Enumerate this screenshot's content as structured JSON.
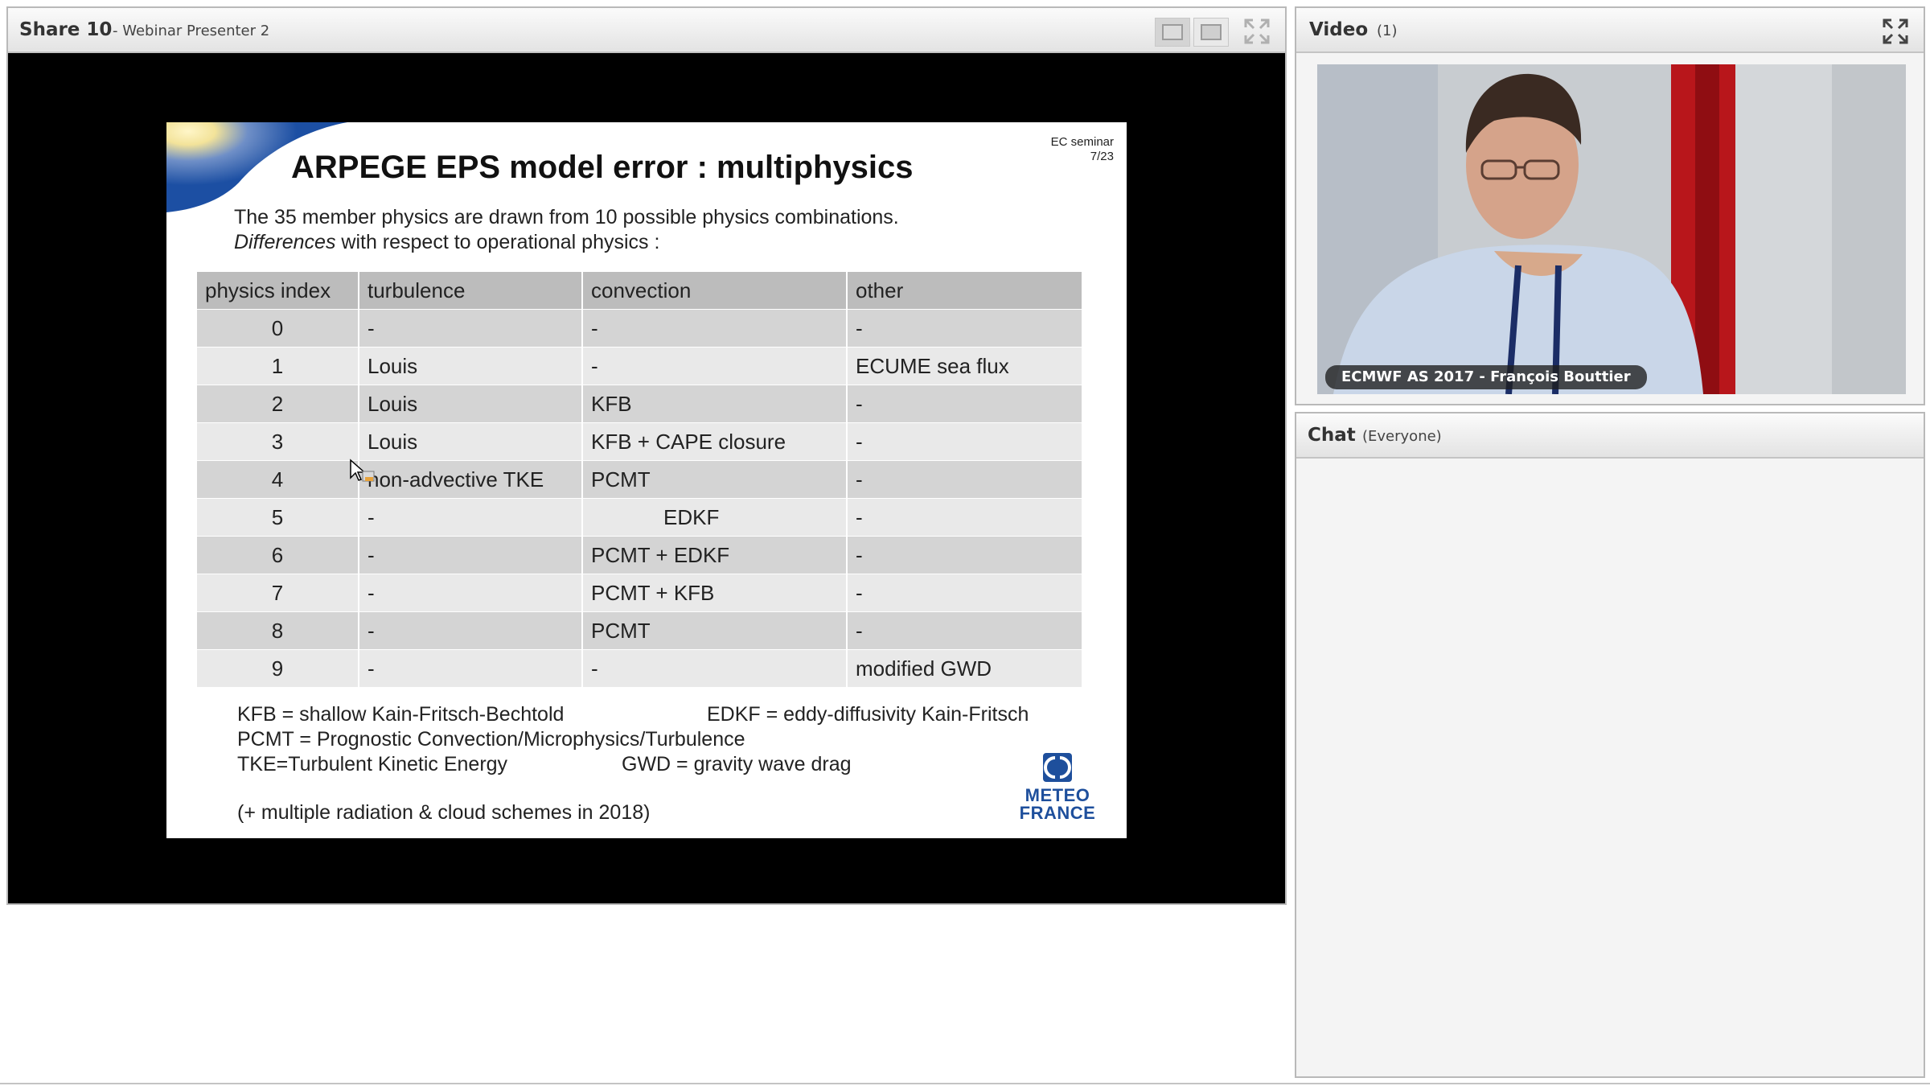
{
  "share_pod": {
    "title": "Share 10",
    "subtitle": "- Webinar Presenter 2"
  },
  "slide": {
    "title": "ARPEGE EPS model error : multiphysics",
    "ref_line1": "EC seminar",
    "ref_line2": "7/23",
    "intro_line1": "The 35 member physics are drawn from 10 possible physics combinations.",
    "intro_line2_italic": "Differences",
    "intro_line2_rest": " with respect to operational physics :",
    "table": {
      "headers": [
        "physics index",
        "turbulence",
        "convection",
        "other"
      ],
      "rows": [
        [
          "0",
          "-",
          "-",
          "-"
        ],
        [
          "1",
          "Louis",
          "-",
          "ECUME sea flux"
        ],
        [
          "2",
          "Louis",
          "KFB",
          "-"
        ],
        [
          "3",
          "Louis",
          "KFB + CAPE closure",
          "-"
        ],
        [
          "4",
          "non-advective TKE",
          "PCMT",
          "-"
        ],
        [
          "5",
          "-",
          "EDKF",
          "-"
        ],
        [
          "6",
          "-",
          "PCMT + EDKF",
          "-"
        ],
        [
          "7",
          "-",
          "PCMT + KFB",
          "-"
        ],
        [
          "8",
          "-",
          "PCMT",
          "-"
        ],
        [
          "9",
          "-",
          "-",
          "modified GWD"
        ]
      ]
    },
    "defs": {
      "kfb": "KFB = shallow Kain-Fritsch-Bechtold",
      "edkf": "EDKF = eddy-diffusivity Kain-Fritsch",
      "pcmt": "PCMT = Prognostic Convection/Microphysics/Turbulence",
      "tke": "TKE=Turbulent Kinetic Energy",
      "gwd": "GWD = gravity wave drag"
    },
    "note": "(+ multiple radiation & cloud schemes in 2018)",
    "logo_line1": "METEO",
    "logo_line2": "FRANCE"
  },
  "video_pod": {
    "title": "Video",
    "count": "(1)",
    "caption": "ECMWF AS 2017 - François Bouttier"
  },
  "chat_pod": {
    "title": "Chat",
    "scope": "(Everyone)"
  },
  "icons": {
    "layout_1": "single-layout-icon",
    "layout_2": "wide-layout-icon",
    "fullscreen": "fullscreen-icon",
    "cursor": "mouse-pointer-icon"
  },
  "colors": {
    "logo_blue": "#1e4f9c",
    "table_header": "#bcbcbc",
    "row_dark": "#d4d4d4",
    "row_light": "#e9e9e9"
  }
}
